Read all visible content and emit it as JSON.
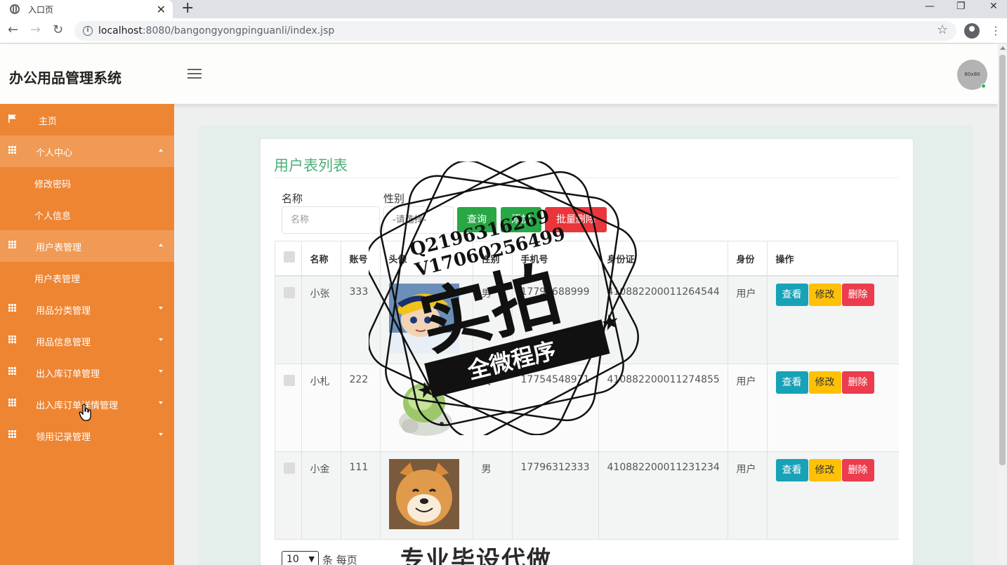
{
  "browser": {
    "tab_title": "入口页",
    "tab_close": "✕",
    "new_tab": "+",
    "url_host": "localhost",
    "url_path": ":8080/bangongyongpinguanli/index.jsp",
    "window_minimize": "—",
    "window_restore": "❐",
    "window_close": "✕"
  },
  "header": {
    "brand": "办公用品管理系统",
    "avatar_text": "80x80"
  },
  "sidebar": {
    "home": "主页",
    "personal_center": "个人中心",
    "change_password": "修改密码",
    "personal_info": "个人信息",
    "user_table_mgmt": "用户表管理",
    "user_table_sub": "用户表管理",
    "category_mgmt": "用品分类管理",
    "item_info_mgmt": "用品信息管理",
    "inout_order_mgmt": "出入库订单管理",
    "inout_detail_mgmt": "出入库订单详情管理",
    "usage_record_mgmt": "领用记录管理"
  },
  "list": {
    "title": "用户表列表",
    "filter_name_label": "名称",
    "filter_name_placeholder": "名称",
    "filter_gender_label": "性别",
    "filter_gender_value": "-请选择-",
    "btn_query": "查询",
    "btn_add": "添加",
    "btn_batch_delete": "批量删除"
  },
  "table": {
    "headers": [
      "名称",
      "账号",
      "头像",
      "性别",
      "手机号",
      "身份证",
      "身份",
      "操作"
    ],
    "rows": [
      {
        "name": "小张",
        "account": "333",
        "gender": "男",
        "phone": "17796688999",
        "id_card": "410882200011264544",
        "role": "用户"
      },
      {
        "name": "小札",
        "account": "222",
        "gender": "女",
        "phone": "17754548971",
        "id_card": "410882200011274855",
        "role": "用户"
      },
      {
        "name": "小金",
        "account": "111",
        "gender": "男",
        "phone": "17796312333",
        "id_card": "410882200011231234",
        "role": "用户"
      }
    ],
    "action_view": "查看",
    "action_edit": "修改",
    "action_delete": "删除"
  },
  "pager": {
    "page_size": "10",
    "page_size_label": "条 每页"
  },
  "watermark": {
    "line1": "Q2196316269",
    "line2": "V17060256499",
    "big": "实拍",
    "ribbon": "全微程序",
    "bottom": "专业毕设代做"
  },
  "colors": {
    "sidebar": "#ee8533",
    "sidebar_active": "#f09a55",
    "title_green": "#4caf77",
    "btn_green": "#28a745",
    "btn_red": "#e8363c",
    "view_teal": "#17a2b8",
    "edit_yellow": "#ffc107",
    "delete_red": "#ec3c4d"
  }
}
